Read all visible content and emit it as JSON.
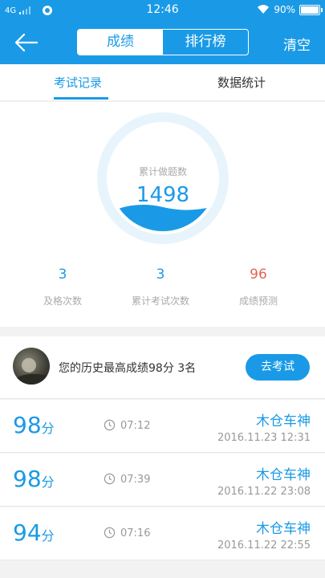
{
  "status_bar": {
    "network": "4G",
    "time": "12:46",
    "battery": "90%",
    "battery_level": 0.9
  },
  "app_bar": {
    "tabs": [
      "成绩",
      "排行榜"
    ],
    "clear_label": "清空"
  },
  "sub_tabs": [
    "考试记录",
    "数据统计"
  ],
  "summary": {
    "label": "累计做题数",
    "count": "1498",
    "stats": [
      {
        "value": "3",
        "label": "及格次数",
        "color": "#1a9ae6"
      },
      {
        "value": "3",
        "label": "累计考试次数",
        "color": "#1a9ae6"
      },
      {
        "value": "96",
        "label": "成绩预测",
        "color": "#e0665a"
      }
    ]
  },
  "history": {
    "text": "您的历史最高成绩98分  3名",
    "button": "去考试"
  },
  "records": [
    {
      "score": "98",
      "unit": "分",
      "duration": "07:12",
      "name": "木仓车神",
      "date": "2016.11.23   12:31"
    },
    {
      "score": "98",
      "unit": "分",
      "duration": "07:39",
      "name": "木仓车神",
      "date": "2016.11.22   23:08"
    },
    {
      "score": "94",
      "unit": "分",
      "duration": "07:16",
      "name": "木仓车神",
      "date": "2016.11.22   22:55"
    }
  ]
}
